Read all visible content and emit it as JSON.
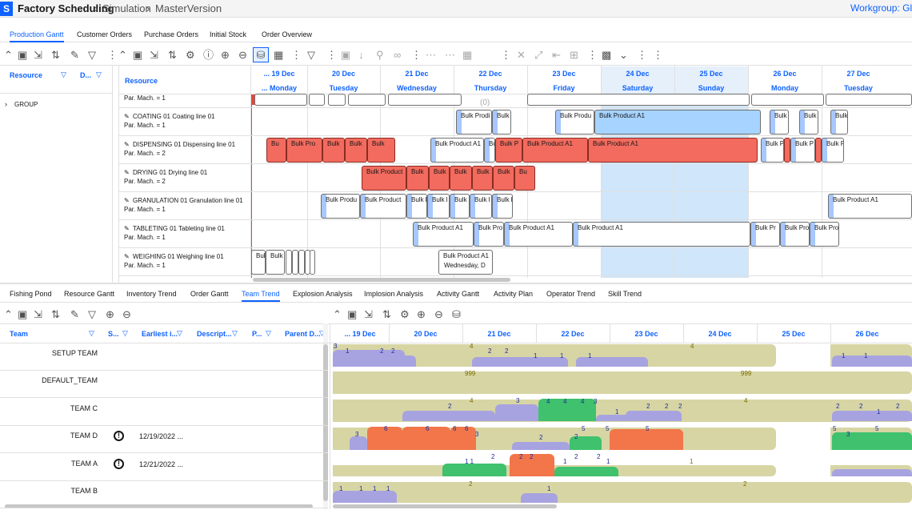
{
  "app": {
    "logo_text": "S",
    "title": "Factory Scheduling",
    "crumb1": "Simulation",
    "crumb2": "MasterVersion",
    "workgroup": "Workgroup: Glo"
  },
  "tabs": [
    "Production Gantt",
    "Customer Orders",
    "Purchase Orders",
    "Initial Stock",
    "Order Overview"
  ],
  "left_grid": {
    "col_resource": "Resource",
    "col_d": "D...",
    "group": "GROUP"
  },
  "gantt_header": {
    "resource": "Resource",
    "days": [
      {
        "date": "... 19 Dec",
        "name": "... Monday"
      },
      {
        "date": "20 Dec",
        "name": "Tuesday"
      },
      {
        "date": "21 Dec",
        "name": "Wednesday"
      },
      {
        "date": "22 Dec",
        "name": "Thursday"
      },
      {
        "date": "23 Dec",
        "name": "Friday"
      },
      {
        "date": "24 Dec",
        "name": "Saturday"
      },
      {
        "date": "25 Dec",
        "name": "Sunday"
      },
      {
        "date": "26 Dec",
        "name": "Monday"
      },
      {
        "date": "27 Dec",
        "name": "Tuesday"
      }
    ]
  },
  "toolbar": {
    "count": "(0)"
  },
  "resources": [
    {
      "name": "",
      "par": "Par. Mach. = 1"
    },
    {
      "name": "COATING 01 Coating line 01",
      "par": "Par. Mach. = 1"
    },
    {
      "name": "DISPENSING 01 Dispensing line 01",
      "par": "Par. Mach. = 2"
    },
    {
      "name": "DRYING 01 Drying line 01",
      "par": "Par. Mach. = 2"
    },
    {
      "name": "GRANULATION 01 Granulation line 01",
      "par": "Par. Mach. = 1"
    },
    {
      "name": "TABLETING 01 Tableting line 01",
      "par": "Par. Mach. = 1"
    },
    {
      "name": "WEIGHING 01 Weighing line 01",
      "par": "Par. Mach. = 1"
    }
  ],
  "task_labels": {
    "bulk_a1": "Bulk Product A1",
    "bulk_prod": "Bulk Produ",
    "bulk_pro": "Bulk Pro",
    "bulk": "Bulk",
    "bulk_p": "Bulk P",
    "bulk_prodi": "Bulk Prodi",
    "bulk_product": "Bulk Product",
    "bulk_pr": "Bulk Pr",
    "bulk_short": "Bulk l",
    "bu": "Bu",
    "wednesday": "Wednesday, D"
  },
  "bottom_tabs": [
    "Fishing Pond",
    "Resource Gantt",
    "Inventory Trend",
    "Order Gantt",
    "Team Trend",
    "Explosion Analysis",
    "Implosion Analysis",
    "Activity Gantt",
    "Activity Plan",
    "Operator Trend",
    "Skill Trend"
  ],
  "team_header": {
    "team": "Team",
    "s": "S...",
    "earliest": "Earliest i...",
    "desc": "Descript...",
    "p": "P...",
    "parent": "Parent D..."
  },
  "teams": [
    {
      "name": "SETUP TEAM",
      "date": ""
    },
    {
      "name": "DEFAULT_TEAM",
      "date": ""
    },
    {
      "name": "TEAM C",
      "date": ""
    },
    {
      "name": "TEAM D",
      "date": "12/19/2022 ..."
    },
    {
      "name": "TEAM A",
      "date": "12/21/2022 ..."
    },
    {
      "name": "TEAM B",
      "date": ""
    }
  ],
  "trend_days": [
    "... 19 Dec",
    "20 Dec",
    "21 Dec",
    "22 Dec",
    "23 Dec",
    "24 Dec",
    "25 Dec",
    "26 Dec"
  ],
  "trend_labels": {
    "n999": "999",
    "n4": "4",
    "n3": "3",
    "n2": "2",
    "n1": "1",
    "n5": "5",
    "n6": "6",
    "n11": "1 1"
  },
  "colors": {
    "accent": "#0f62fe",
    "red_task": "#f26b5e",
    "team_band": "#d7d5a4",
    "team_load": "#a7a3e0",
    "team_green": "#3fc16d",
    "team_orange": "#f2764a"
  }
}
